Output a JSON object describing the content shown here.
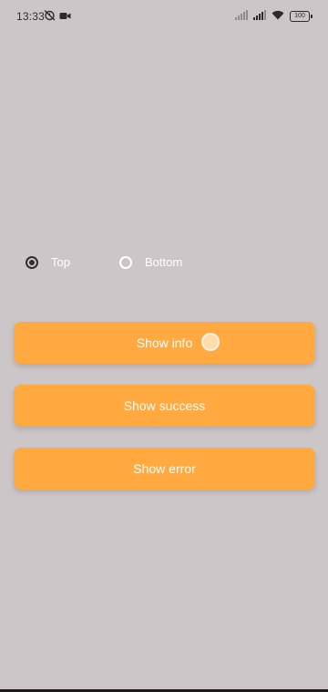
{
  "status_bar": {
    "time": "13:33",
    "battery_level": "100",
    "left_icons": [
      "alarm-off-icon",
      "video-icon"
    ],
    "right_icons": [
      "signal-weak-icon",
      "signal-icon",
      "wifi-icon",
      "battery-icon"
    ]
  },
  "position_options": {
    "selected": "Top",
    "items": [
      {
        "label": "Top",
        "checked": true
      },
      {
        "label": "Bottom",
        "checked": false
      }
    ]
  },
  "buttons": {
    "info_label": "Show info",
    "success_label": "Show success",
    "error_label": "Show error"
  },
  "colors": {
    "background": "#cdc6c8",
    "button": "#ffa940",
    "button_text": "#ffffff"
  }
}
